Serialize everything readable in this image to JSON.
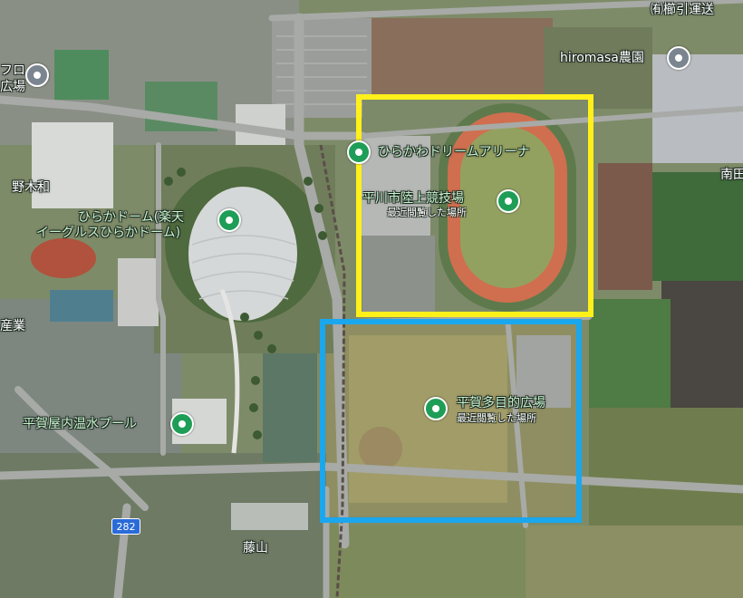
{
  "labels": {
    "yuugen": "㈲櫛引運送",
    "hiromasa": "hiromasa農園",
    "furo": "フロ",
    "ba": "広場",
    "nogiwa": "野木和",
    "nanden": "南田",
    "dome_line1": "ひらかドーム(楽天",
    "dome_line2": "イーグルスひらかドーム)",
    "arena": "ひらかわドリームアリーナ",
    "stadium": "平川市陸上競技場",
    "stadium_sub": "最近閲覧した場所",
    "hiroba": "平賀多目的広場",
    "hiroba_sub": "最近閲覧した場所",
    "pool": "平賀屋内温水プール",
    "gyou": "産業",
    "fujiyama": "藤山",
    "route": "282"
  },
  "colors": {
    "highlight_yellow": "#fff01a",
    "highlight_blue": "#1aa7ee",
    "poi_green": "#1e9d57",
    "poi_grey": "#7b8590",
    "route_shield": "#2a6bd8"
  },
  "icons": {
    "park_pin": "green-place-pin-icon",
    "generic_pin": "grey-place-pin-icon"
  }
}
